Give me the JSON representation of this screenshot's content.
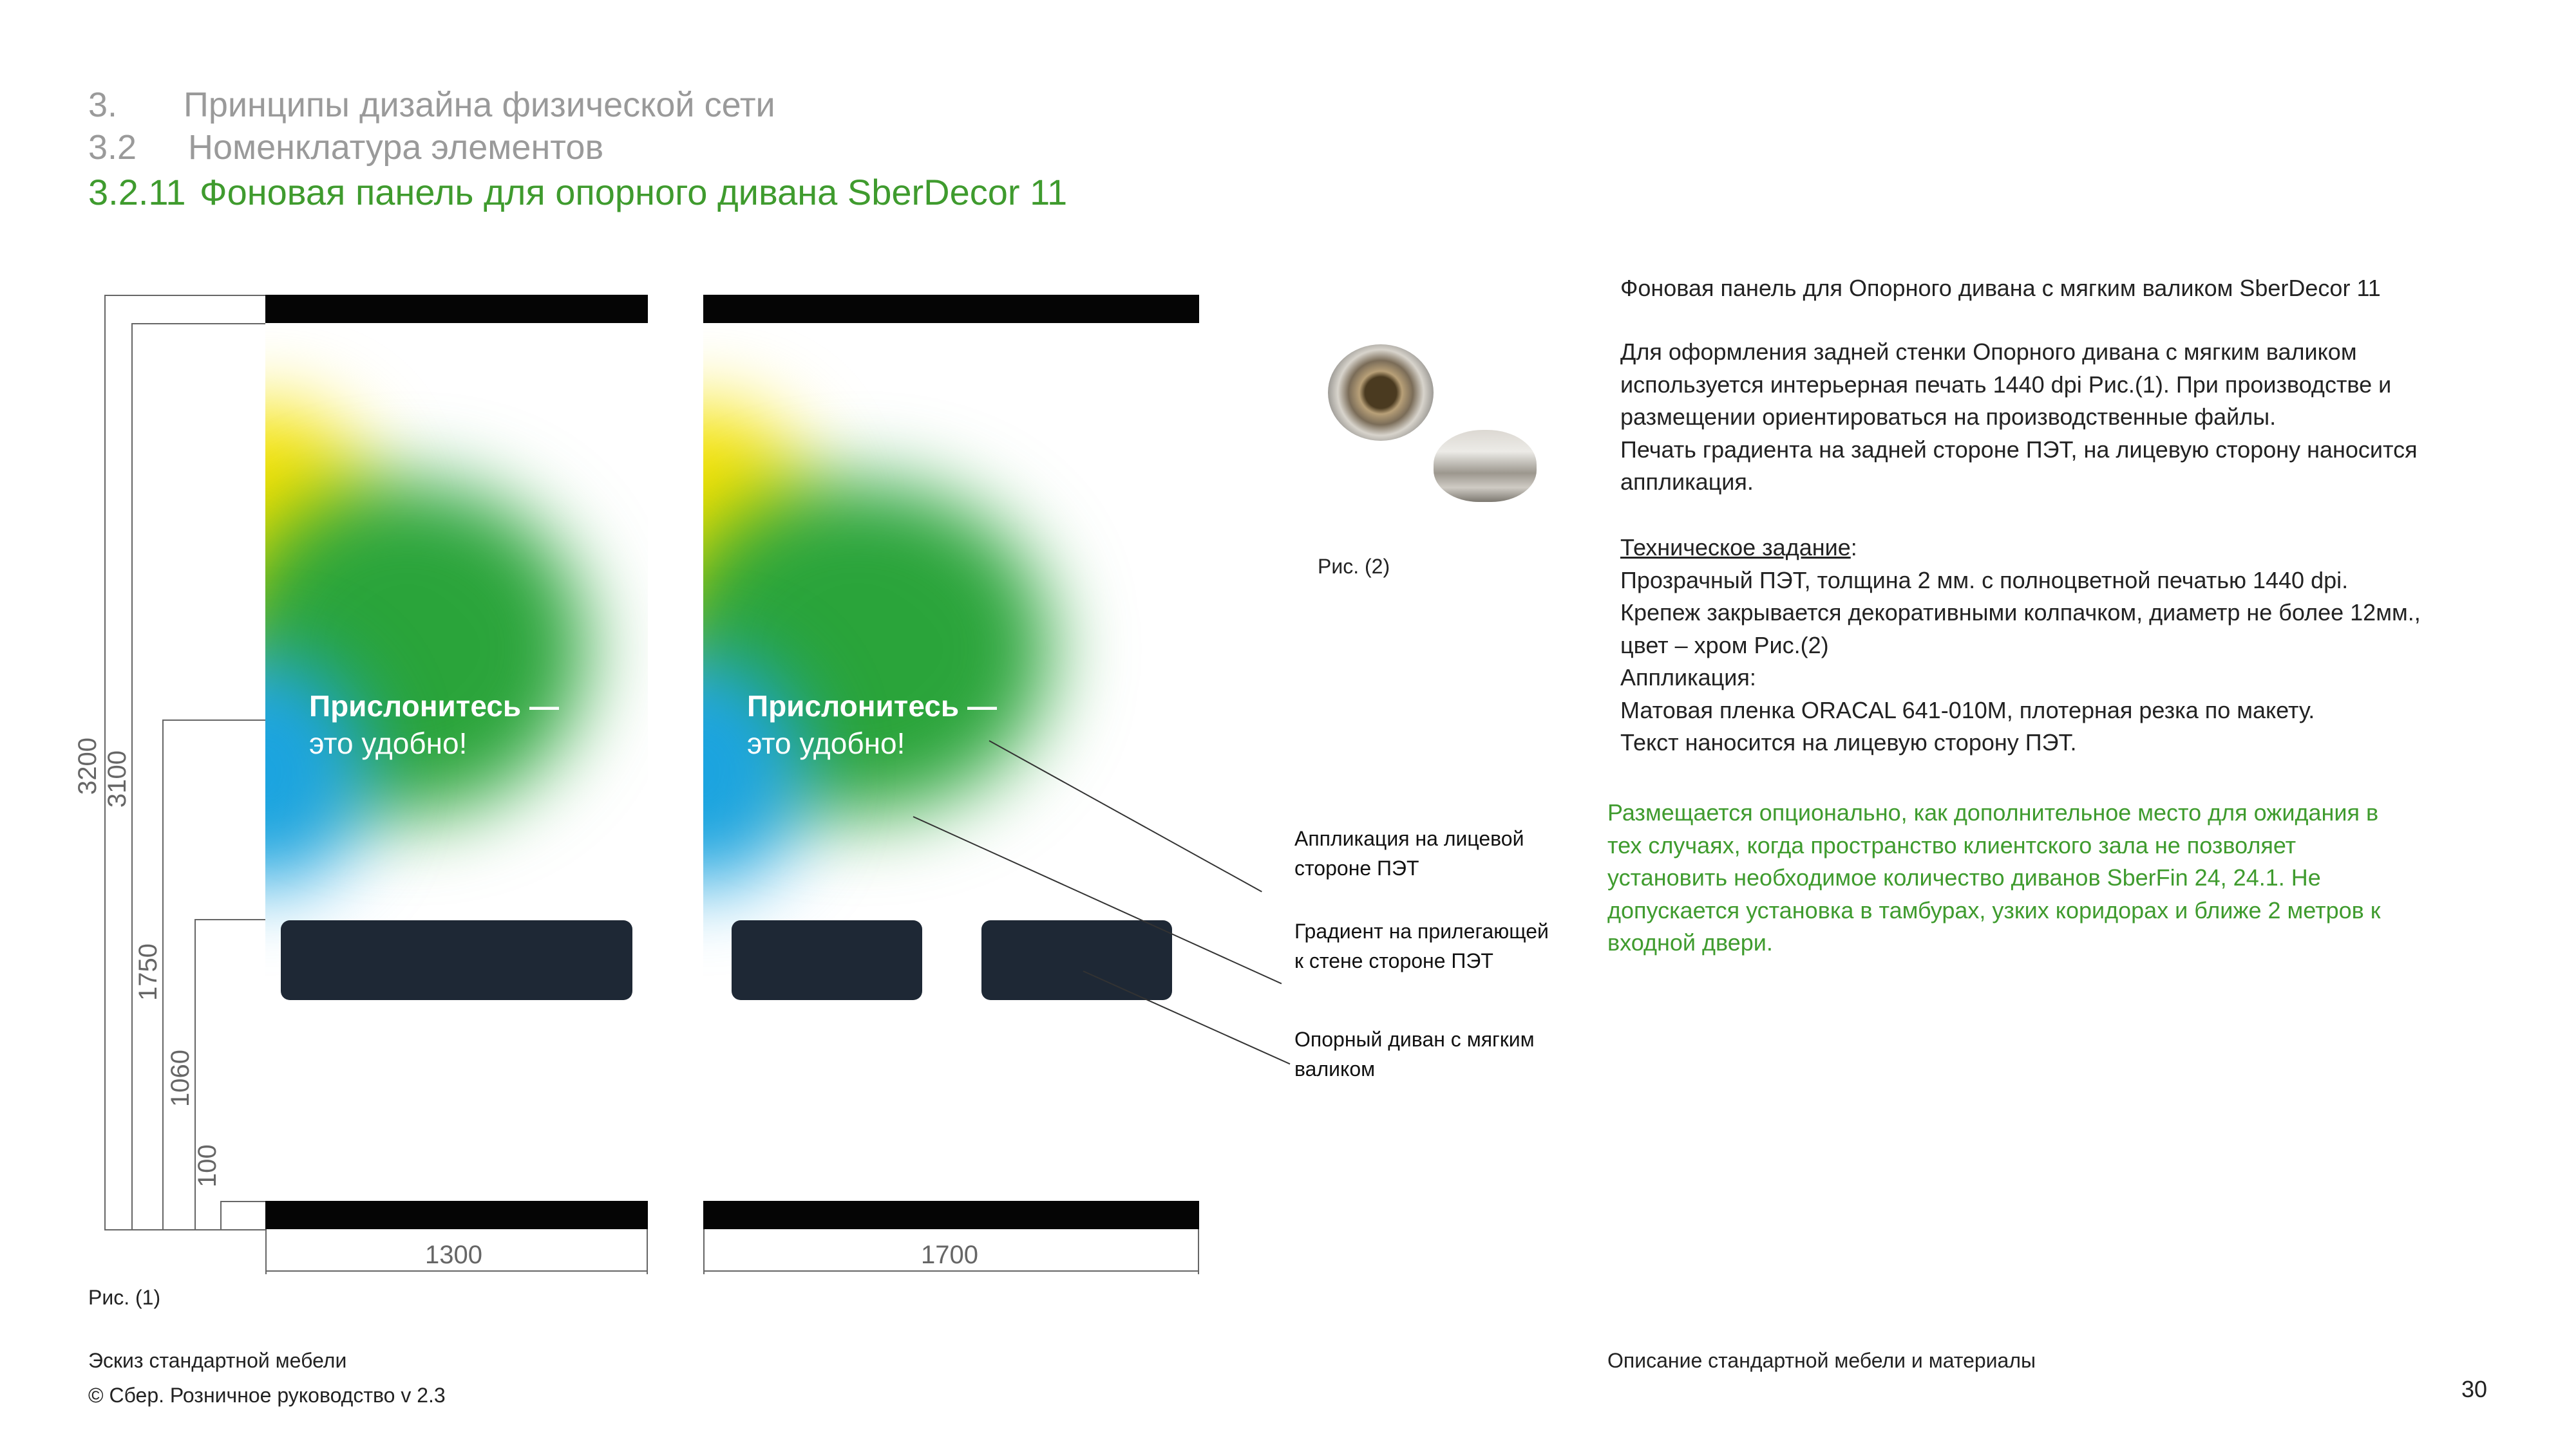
{
  "header": {
    "h1_num": "3.",
    "h1_text": "Принципы дизайна физической сети",
    "h2_num": "3.2",
    "h2_text": "Номенклатура элементов",
    "h3_num": "3.2.11",
    "h3_text": "Фоновая панель для опорного дивана SberDecor 11"
  },
  "drawing": {
    "slogan_line1": "Прислонитесь —",
    "slogan_line2": "это удобно!",
    "dims_vertical": [
      "3200",
      "3100",
      "1750",
      "1060",
      "100"
    ],
    "width_left": "1300",
    "width_right": "1700",
    "caption": "Рис. (1)"
  },
  "callouts": [
    {
      "line1": "Аппликация на лицевой",
      "line2": "стороне ПЭТ"
    },
    {
      "line1": "Градиент на прилегающей",
      "line2": "к стене стороне ПЭТ"
    },
    {
      "line1": "Опорный диван с мягким",
      "line2": "валиком"
    }
  ],
  "fig2_caption": "Рис. (2)",
  "description": {
    "title": "Фоновая панель для Опорного дивана с мягким валиком SberDecor 11",
    "p1": [
      "Для оформления задней стенки Опорного дивана с мягким валиком",
      "используется интерьерная печать 1440 dpi Рис.(1). При производстве и",
      "размещении ориентироваться на производственные файлы.",
      "Печать градиента на задней стороне ПЭТ, на лицевую сторону наносится",
      "аппликация."
    ],
    "spec_label": "Техническое задание",
    "spec_colon": ":",
    "spec": [
      "Прозрачный ПЭТ, толщина 2 мм. с полноцветной печатью 1440 dpi.",
      "Крепеж закрывается декоративными колпачком, диаметр не более 12мм.,",
      "цвет – хром Рис.(2)",
      "Аппликация:",
      "Матовая пленка ORACAL 641-010M, плотерная резка по макету.",
      "Текст наносится на лицевую сторону ПЭТ."
    ],
    "note": [
      "Размещается опционально, как дополнительное место для ожидания в",
      "тех случаях, когда пространство клиентского зала не позволяет",
      "установить необходимое количество диванов SberFin 24, 24.1. Не",
      "допускается установка в тамбурах, узких коридорах и ближе 2 метров к",
      "входной двери."
    ]
  },
  "footer": {
    "left1": "Эскиз стандартной мебели",
    "left2": "© Сбер. Розничное руководство  v 2.3",
    "center": "Описание  стандартной мебели и материалы",
    "page": "30"
  },
  "colors": {
    "accent_green": "#3f9b2e",
    "heading_gray": "#9a9a9a",
    "seat_dark": "#1e2835"
  }
}
